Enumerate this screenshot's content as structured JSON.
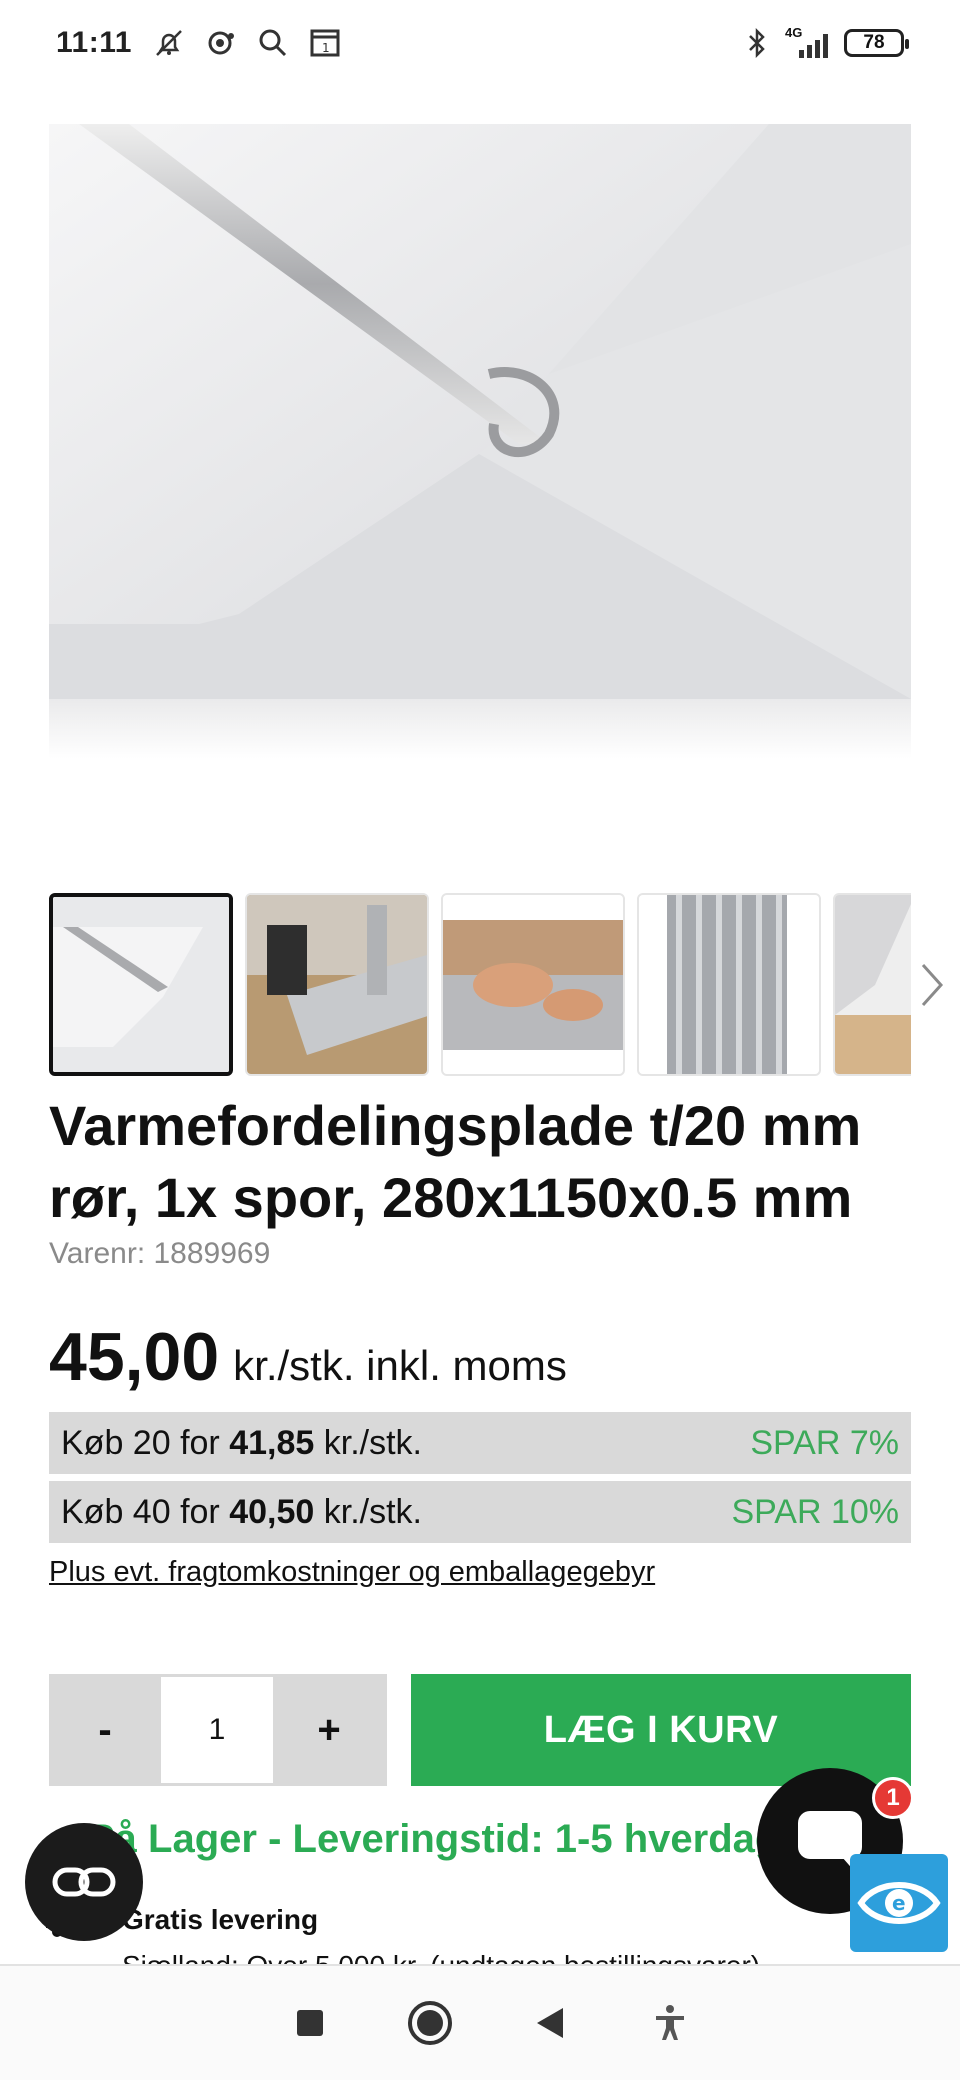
{
  "status_bar": {
    "time": "11:11",
    "network": "4G",
    "battery": "78"
  },
  "product": {
    "title": "Varmefordelingsplade t/20 mm rør, 1x spor, 280x1150x0.5 mm",
    "sku": "Varenr: 1889969",
    "price": "45,00",
    "price_unit": "kr./stk. inkl. moms",
    "tiers": [
      {
        "prefix": "Køb 20 for",
        "price": "41,85",
        "unit": "kr./stk.",
        "save": "SPAR 7%"
      },
      {
        "prefix": "Køb 40 for",
        "price": "40,50",
        "unit": "kr./stk.",
        "save": "SPAR 10%"
      }
    ],
    "freight_link": "Plus evt. fragtomkostninger og emballagegebyr"
  },
  "purchase": {
    "minus": "-",
    "quantity": "1",
    "plus": "+",
    "add_to_basket": "LÆG I KURV"
  },
  "stock": {
    "text": "På Lager - Leveringstid: 1-5 hverdage",
    "delivery_title": "Gratis levering",
    "delivery_sub": "Sjælland: Over 5.000 kr. (undtagen bestillingsvarer)"
  },
  "chat": {
    "badge": "1"
  },
  "colors": {
    "accent_green": "#2bab54",
    "save_green": "#3daa5a",
    "tier_bg": "#d9d9d9",
    "chat_badge": "#e53935",
    "accessibility_blue": "#2d9fdc"
  },
  "icons": {
    "status_left": [
      "notification-off-icon",
      "chat-status-icon",
      "search-icon",
      "calendar-icon"
    ],
    "status_right": [
      "bluetooth-icon",
      "signal-icon",
      "battery-icon"
    ],
    "nav": [
      "recents-square-icon",
      "home-circle-icon",
      "back-triangle-icon",
      "accessibility-person-icon"
    ]
  }
}
